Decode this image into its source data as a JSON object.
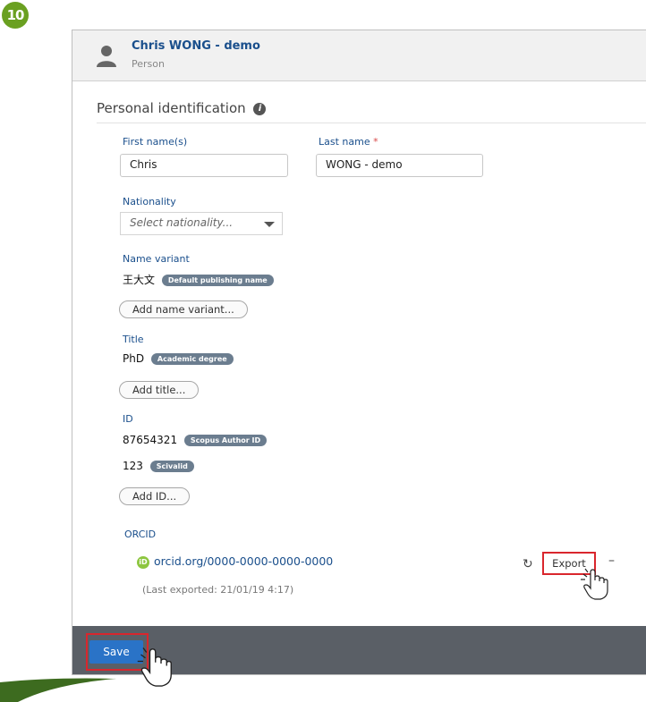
{
  "step_number": "10",
  "person": {
    "name": "Chris WONG - demo",
    "type": "Person"
  },
  "section": {
    "title": "Personal identification"
  },
  "first_name": {
    "label": "First name(s)",
    "value": "Chris"
  },
  "last_name": {
    "label": "Last name",
    "required_mark": "*",
    "value": "WONG - demo"
  },
  "nationality": {
    "label": "Nationality",
    "placeholder": "Select nationality..."
  },
  "name_variant": {
    "label": "Name variant",
    "value": "王大文",
    "badge": "Default publishing name",
    "add_button": "Add name variant..."
  },
  "title": {
    "label": "Title",
    "value": "PhD",
    "badge": "Academic degree",
    "add_button": "Add title..."
  },
  "id": {
    "label": "ID",
    "entries": [
      {
        "value": "87654321",
        "badge": "Scopus Author ID"
      },
      {
        "value": "123",
        "badge": "Scivalid"
      }
    ],
    "add_button": "Add ID..."
  },
  "orcid": {
    "label": "ORCID",
    "logo": "iD",
    "host": "orcid.org/",
    "number": "0000-0000-0000-0000",
    "last_exported": "(Last exported: 21/01/19 4:17)",
    "export_button": "Export",
    "remove": "–"
  },
  "footer": {
    "save_button": "Save"
  },
  "colors": {
    "accent": "#1a4f8c",
    "highlight": "#d9262d",
    "step_badge": "#6aa021",
    "footer": "#5a5f66"
  }
}
